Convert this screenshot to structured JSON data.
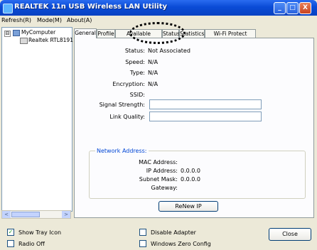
{
  "window": {
    "title": "REALTEK 11n USB Wireless LAN Utility",
    "controls": {
      "minimize": "_",
      "maximize": "□",
      "close": "X"
    }
  },
  "menu": [
    "Refresh(R)",
    "Mode(M)",
    "About(A)"
  ],
  "tree": {
    "root_expander": "⊟",
    "root": "MyComputer",
    "child": "Realtek RTL8191"
  },
  "scroll": {
    "left": "<",
    "right": ">"
  },
  "tabs": [
    "General",
    "Profile",
    "Available Network",
    "Status",
    "Statistics",
    "Wi-Fi Protect Setup"
  ],
  "general": {
    "status_label": "Status:",
    "status_value": "Not Associated",
    "speed_label": "Speed:",
    "speed_value": "N/A",
    "type_label": "Type:",
    "type_value": "N/A",
    "encryption_label": "Encryption:",
    "encryption_value": "N/A",
    "ssid_label": "SSID:",
    "ssid_value": "",
    "signal_label": "Signal Strength:",
    "link_label": "Link Quality:"
  },
  "network_address": {
    "title": "Network Address:",
    "mac_label": "MAC Address:",
    "mac_value": "",
    "ip_label": "IP Address:",
    "ip_value": "0.0.0.0",
    "mask_label": "Subnet Mask:",
    "mask_value": "0.0.0.0",
    "gateway_label": "Gateway:",
    "gateway_value": ""
  },
  "renew_button": "ReNew IP",
  "bottom": {
    "show_tray": {
      "label": "Show Tray Icon",
      "checked": true,
      "mark": "✓"
    },
    "radio_off": {
      "label": "Radio Off",
      "checked": false
    },
    "disable_adapter": {
      "label": "Disable Adapter",
      "checked": false
    },
    "windows_zero": {
      "label": "Windows Zero Config",
      "checked": false
    },
    "close_button": "Close"
  }
}
